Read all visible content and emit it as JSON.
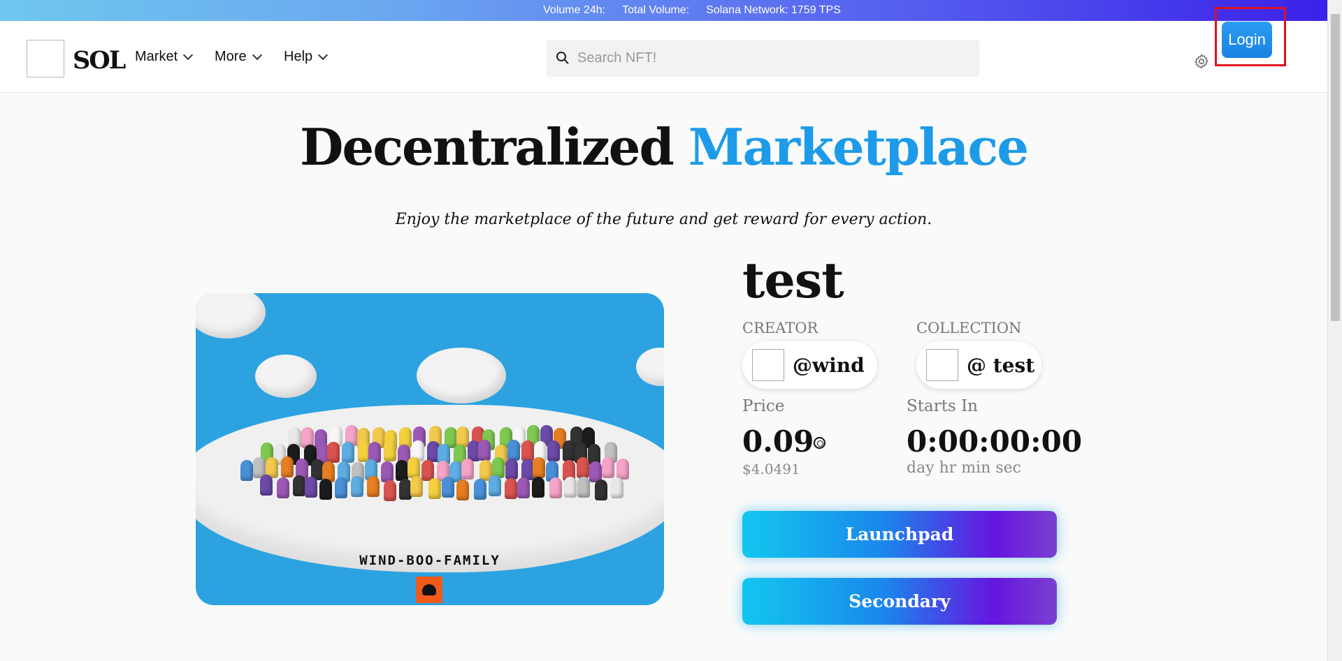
{
  "ticker": {
    "volume_24h": "Volume 24h:",
    "total_volume": "Total Volume:",
    "network": "Solana Network: 1759 TPS"
  },
  "header": {
    "brand": "SOL",
    "nav": [
      {
        "label": "Market"
      },
      {
        "label": "More"
      },
      {
        "label": "Help"
      }
    ],
    "search_placeholder": "Search NFT!",
    "login_label": "Login"
  },
  "hero": {
    "title_part1": "Decentralized",
    "title_part2": "Marketplace",
    "subtitle": "Enjoy the marketplace of the future and get reward for every action."
  },
  "artwork": {
    "caption": "WIND-BOO-FAMILY"
  },
  "nft": {
    "title": "test",
    "creator_label": "CREATOR",
    "creator_name": "@wind",
    "collection_label": "COLLECTION",
    "collection_name": "@ test",
    "price_label": "Price",
    "price_value": "0.09",
    "price_usd": "$4.0491",
    "starts_label": "Starts In",
    "countdown": "0:00:00:00",
    "countdown_units": "day hr min sec",
    "launchpad_label": "Launchpad",
    "secondary_label": "Secondary"
  },
  "colors": {
    "accent": "#1d9be8",
    "login_highlight": "#e0101f"
  }
}
